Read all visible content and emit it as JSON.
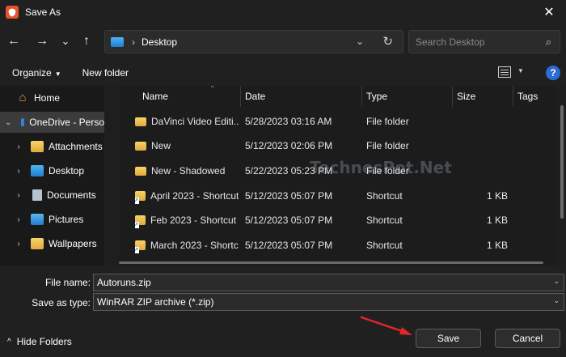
{
  "window": {
    "title": "Save As",
    "close_glyph": "✕"
  },
  "nav": {
    "back": "←",
    "forward": "→",
    "recent": "⌄",
    "up": "↑"
  },
  "address": {
    "separator": "›",
    "location": "Desktop",
    "dropdown": "⌄",
    "refresh": "↻"
  },
  "search": {
    "placeholder": "Search Desktop",
    "icon": "⌕"
  },
  "commands": {
    "organize": "Organize",
    "organize_caret": "▼",
    "new_folder": "New folder",
    "help": "?"
  },
  "sidebar": {
    "items": [
      {
        "label": "Home",
        "icon": "home-icon"
      },
      {
        "label": "OneDrive - Perso",
        "icon": "cloud-icon",
        "selected": true
      },
      {
        "label": "Attachments",
        "icon": "folder-icon"
      },
      {
        "label": "Desktop",
        "icon": "desktop-icon"
      },
      {
        "label": "Documents",
        "icon": "document-icon"
      },
      {
        "label": "Pictures",
        "icon": "pictures-icon"
      },
      {
        "label": "Wallpapers",
        "icon": "folder-icon"
      }
    ]
  },
  "columns": {
    "name": "Name",
    "date": "Date",
    "type": "Type",
    "size": "Size",
    "tags": "Tags"
  },
  "files": [
    {
      "name": "DaVinci Video Editi...",
      "date": "5/28/2023 03:16 AM",
      "type": "File folder",
      "size": "",
      "icon": "folder-icon"
    },
    {
      "name": "New",
      "date": "5/12/2023 02:06 PM",
      "type": "File folder",
      "size": "",
      "icon": "folder-icon"
    },
    {
      "name": "New - Shadowed",
      "date": "5/22/2023 05:23 PM",
      "type": "File folder",
      "size": "",
      "icon": "folder-icon"
    },
    {
      "name": "April 2023 - Shortcut",
      "date": "5/12/2023 05:07 PM",
      "type": "Shortcut",
      "size": "1 KB",
      "icon": "shortcut-icon"
    },
    {
      "name": "Feb 2023 - Shortcut",
      "date": "5/12/2023 05:07 PM",
      "type": "Shortcut",
      "size": "1 KB",
      "icon": "shortcut-icon"
    },
    {
      "name": "March 2023 - Shortc...",
      "date": "5/12/2023 05:07 PM",
      "type": "Shortcut",
      "size": "1 KB",
      "icon": "shortcut-icon"
    }
  ],
  "watermark": "TechnesPot.Net",
  "form": {
    "file_name_label": "File name:",
    "file_name_value": "Autoruns.zip",
    "save_type_label": "Save as type:",
    "save_type_value": "WinRAR ZIP archive (*.zip)"
  },
  "footer": {
    "hide_folders": "Hide Folders",
    "hide_caret": "^",
    "save": "Save",
    "cancel": "Cancel"
  },
  "colors": {
    "accent": "#2a6cd3",
    "annotation_arrow": "#e3262b",
    "folder": "#e8b34a"
  }
}
